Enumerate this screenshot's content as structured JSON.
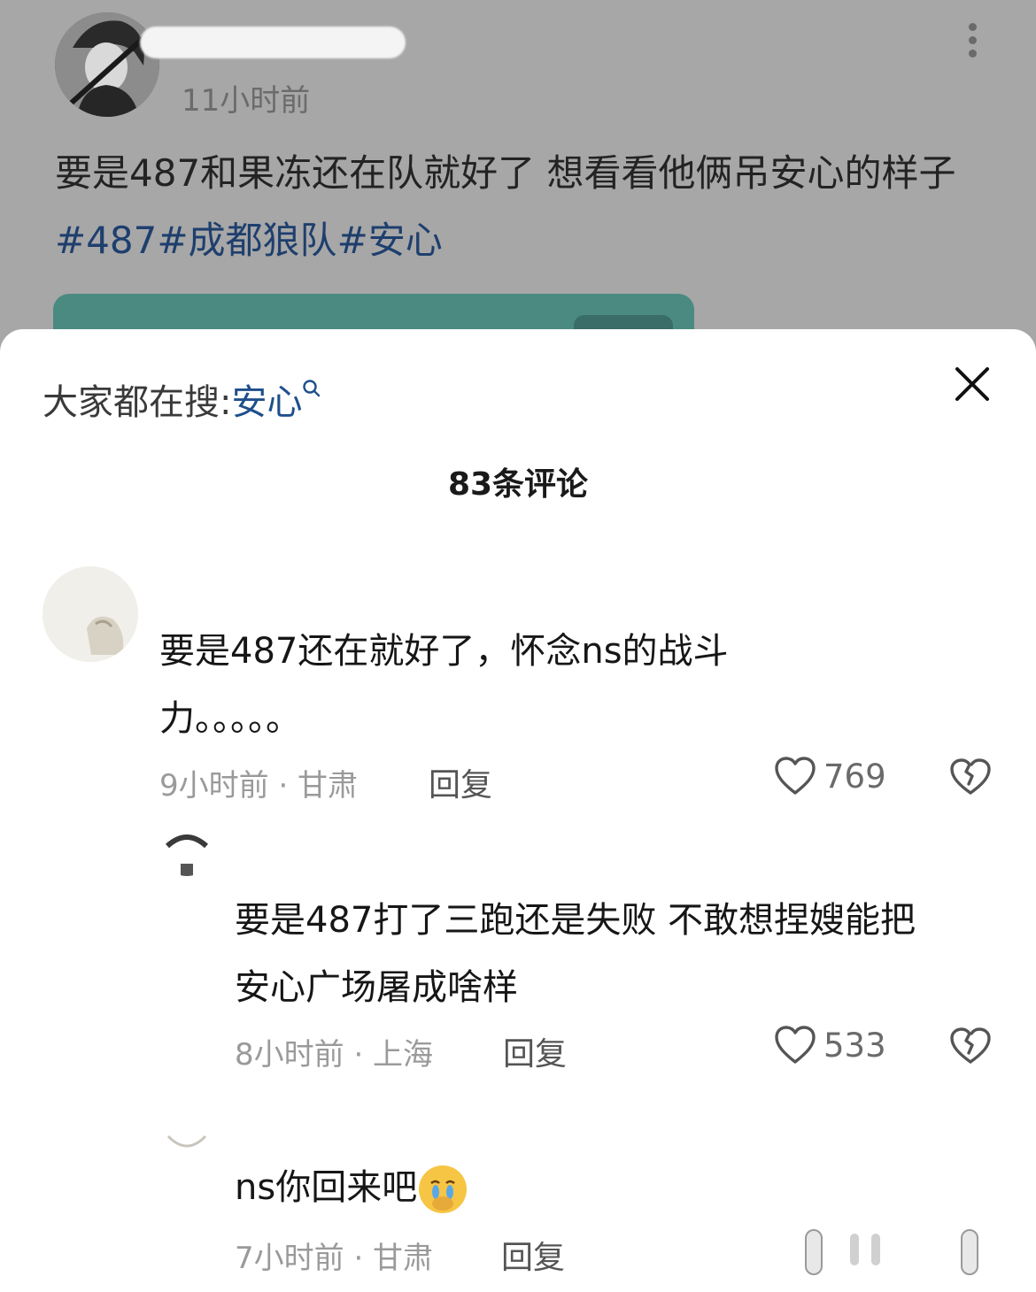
{
  "post": {
    "time": "11小时前",
    "text": "要是487和果冻还在队就好了 想看看他俩吊安心的样子",
    "hashtags": [
      "#487",
      "#成都狼队",
      "#安心"
    ],
    "more_icon": "more-vertical-icon"
  },
  "sheet": {
    "search_prefix": "大家都在搜:",
    "search_keyword": "安心",
    "search_icon": "search-icon",
    "close_icon": "close-icon",
    "comment_count": "83条评论"
  },
  "comments": [
    {
      "line1": "要是487还在就好了，怀念ns的战斗",
      "line2": "力。。。。。",
      "meta": "9小时前 · 甘肃",
      "reply": "回复",
      "likes": "769"
    },
    {
      "line1": "要是487打了三跑还是失败 不敢想捏嫂能把",
      "line2": "安心广场屠成啥样",
      "meta": "8小时前 · 上海",
      "reply": "回复",
      "likes": "533"
    },
    {
      "line1": "ns你回来吧",
      "emoji": "crying-face-emoji",
      "meta": "7小时前 · 甘肃",
      "reply": "回复"
    }
  ],
  "colors": {
    "hashtag": "#1e3f6e",
    "search_keyword": "#1e4f8c",
    "overlay": "#a7a7a7"
  }
}
